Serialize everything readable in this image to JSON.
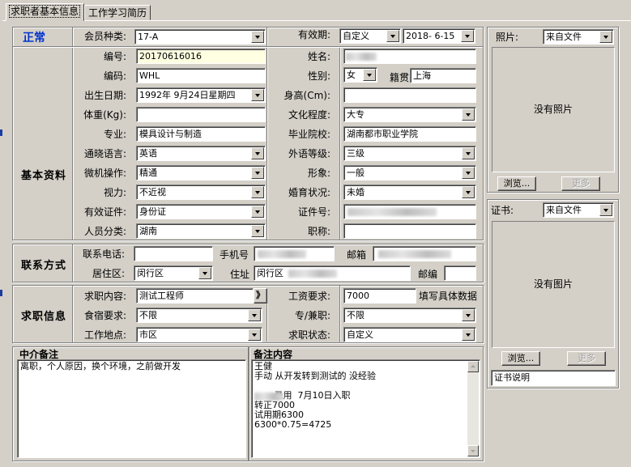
{
  "tabs": {
    "basic": "求职者基本信息",
    "history": "工作学习简历"
  },
  "status": "正常",
  "sections": {
    "basic": "基本资料",
    "contact": "联系方式",
    "job": "求职信息"
  },
  "labels": {
    "member_type": "会员种类:",
    "validity": "有效期:",
    "number": "编号:",
    "name": "姓名:",
    "code": "编码:",
    "gender": "性别:",
    "native": "籍贯",
    "birth": "出生日期:",
    "height": "身高(Cm):",
    "weight": "体重(Kg):",
    "education": "文化程度:",
    "major": "专业:",
    "school": "毕业院校:",
    "language": "通晓语言:",
    "foreign_level": "外语等级:",
    "computer": "微机操作:",
    "appearance": "形象:",
    "vision": "视力:",
    "marital": "婚育状况:",
    "id_type": "有效证件:",
    "id_number": "证件号:",
    "category": "人员分类:",
    "title": "职称:",
    "phone": "联系电话:",
    "mobile": "手机号",
    "email": "邮箱",
    "district": "居住区:",
    "address": "住址",
    "postcode": "邮编",
    "job_content": "求职内容:",
    "salary": "工资要求:",
    "salary_hint": "填写具体数据",
    "lodging": "食宿要求:",
    "parttime": "专/兼职:",
    "work_place": "工作地点:",
    "job_status": "求职状态:",
    "photo": "照片:",
    "certificate": "证书:"
  },
  "values": {
    "member_type": "17-A",
    "validity_type": "自定义",
    "validity_date": "2018- 6-15",
    "number": "20170616016",
    "code": "WHL",
    "gender": "女",
    "native": "上海",
    "birth": "1992年 9月24日星期四",
    "height": "",
    "weight": "",
    "education": "大专",
    "major": "模具设计与制造",
    "school": "湖南都市职业学院",
    "language": "英语",
    "foreign_level": "三级",
    "computer": "精通",
    "appearance": "一般",
    "vision": "不近视",
    "marital": "未婚",
    "id_type": "身份证",
    "category": "湖南",
    "title": "",
    "phone": "",
    "district": "闵行区",
    "address_prefix": "闵行区",
    "postcode": "",
    "job_content": "测试工程师",
    "salary": "7000",
    "lodging": "不限",
    "parttime": "不限",
    "work_place": "市区",
    "job_status": "自定义",
    "photo_source": "来自文件",
    "cert_source": "来自文件",
    "cert_note": "证书说明"
  },
  "buttons": {
    "more_arrow": "》",
    "browse": "浏览...",
    "more": "更多"
  },
  "photo_box": {
    "empty": "没有照片"
  },
  "cert_box": {
    "empty": "没有图片"
  },
  "notes": {
    "agency_title": "中介备注",
    "agency_text": "离职，个人原因，换个环境，之前做开发",
    "remark_title": "备注内容",
    "remark_text": "王健\n手动 从开发转到测试的 没经验\n\n       录用  7月10日入职\n转正7000\n试用期6300\n6300*0.75=4725"
  }
}
